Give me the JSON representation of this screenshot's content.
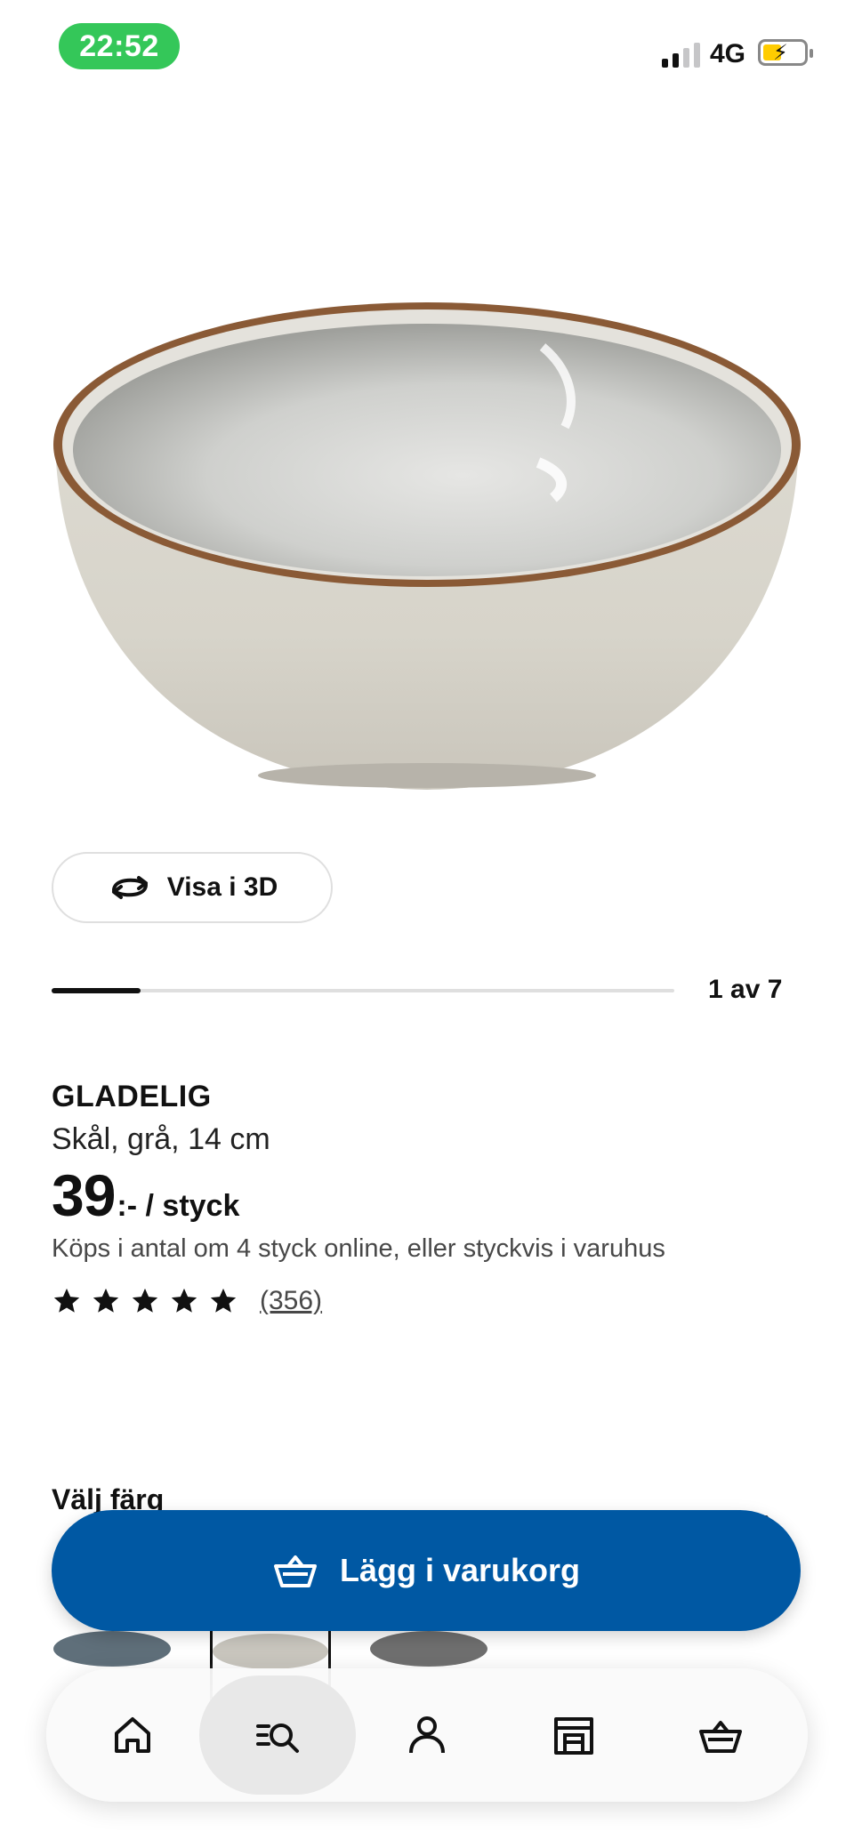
{
  "status_bar": {
    "time": "22:52",
    "network": "4G"
  },
  "product": {
    "image_alt": "Grey ceramic bowl with brown rim",
    "view_3d_label": "Visa i 3D",
    "carousel": {
      "current": 1,
      "total": 7,
      "label": "1 av 7",
      "progress_fraction": 0.1429
    },
    "name": "GLADELIG",
    "description": "Skål, grå, 14 cm",
    "price_integer": "39",
    "price_suffix": ":- / styck",
    "purchase_note": "Köps i antal om 4 styck online, eller styckvis i varuhus",
    "rating": {
      "stars": 5,
      "max_stars": 5,
      "review_count": "(356)"
    }
  },
  "color_selector": {
    "heading": "Välj färg",
    "swatches": [
      {
        "color": "#5f6f7a",
        "selected": false
      },
      {
        "color": "#c9c6be",
        "selected": true
      },
      {
        "color": "#6f6f6f",
        "selected": false
      }
    ]
  },
  "cta": {
    "label": "Lägg i varukorg",
    "color": "#0058a3"
  },
  "bottom_nav": {
    "items": [
      {
        "icon": "home-icon",
        "active": false
      },
      {
        "icon": "search-list-icon",
        "active": true
      },
      {
        "icon": "profile-icon",
        "active": false
      },
      {
        "icon": "store-icon",
        "active": false
      },
      {
        "icon": "basket-icon",
        "active": false
      }
    ]
  }
}
